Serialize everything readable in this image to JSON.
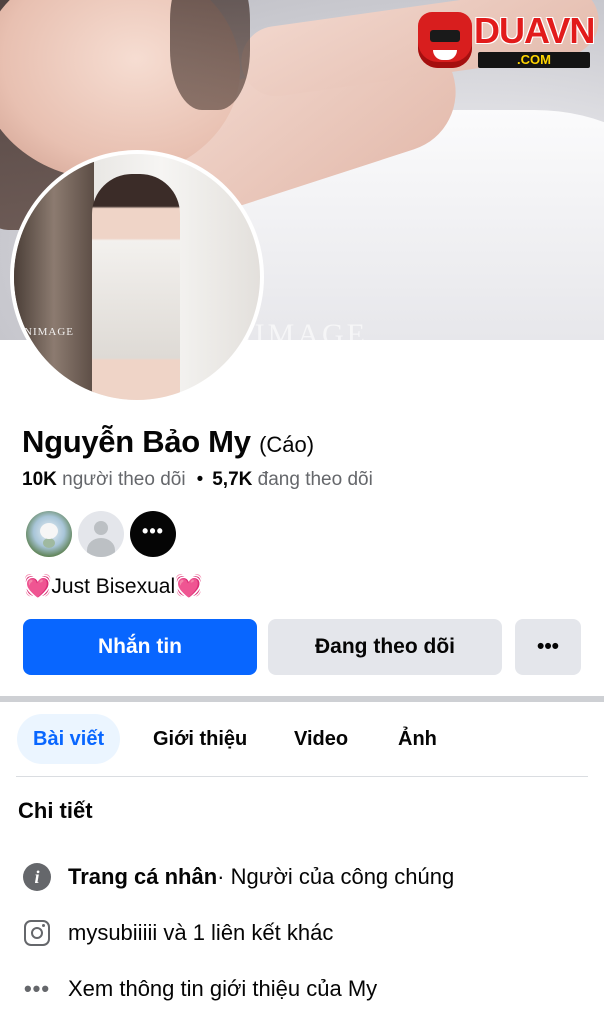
{
  "cover": {
    "watermark": "NIMAGE"
  },
  "brand_logo": {
    "name": "DUAVN",
    "suffix": ".COM"
  },
  "avatar": {
    "watermark": "NIMAGE"
  },
  "profile": {
    "name": "Nguyễn Bảo My",
    "alternate_name": "(Cáo)",
    "followers_count": "10K",
    "followers_label": "người theo dõi",
    "following_count": "5,7K",
    "following_label": "đang theo dõi",
    "separator": "•",
    "bio_text": "Just Bisexual",
    "bio_emoji": "💓"
  },
  "mutual_friends": {
    "more_label": "•••"
  },
  "actions": {
    "message": "Nhắn tin",
    "following": "Đang theo dõi",
    "more": "•••"
  },
  "tabs": [
    {
      "label": "Bài viết",
      "active": true
    },
    {
      "label": "Giới thiệu",
      "active": false
    },
    {
      "label": "Video",
      "active": false
    },
    {
      "label": "Ảnh",
      "active": false
    }
  ],
  "details": {
    "title": "Chi tiết",
    "items": [
      {
        "icon": "info-icon",
        "bold": "Trang cá nhân",
        "text": " · Người của công chúng"
      },
      {
        "icon": "instagram-icon",
        "bold": "",
        "text": "mysubiiiii và 1 liên kết khác"
      },
      {
        "icon": "more-dots-icon",
        "bold": "",
        "text": "Xem thông tin giới thiệu của My"
      }
    ]
  },
  "colors": {
    "primary_blue": "#0866ff",
    "secondary_button": "#e4e6eb",
    "active_tab_bg": "#ebf5ff",
    "muted_text": "#65676b"
  }
}
